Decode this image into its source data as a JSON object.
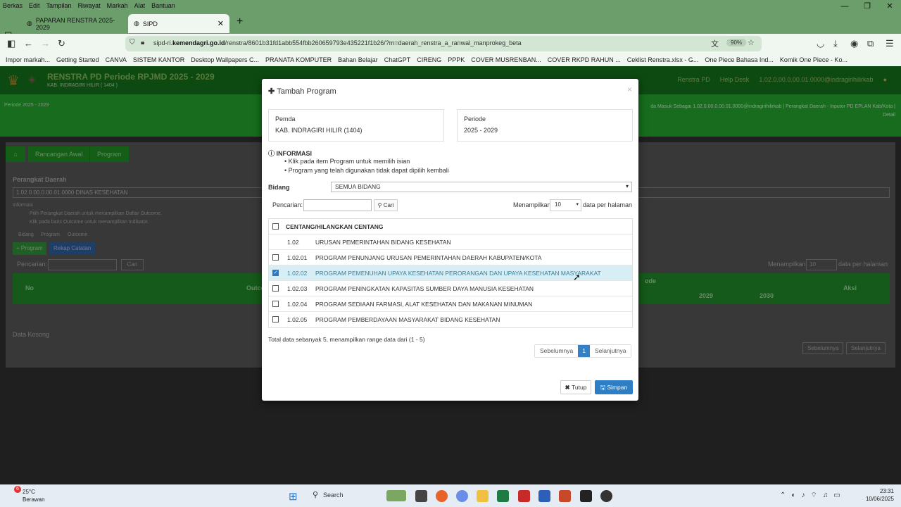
{
  "browser": {
    "menu": [
      "Berkas",
      "Edit",
      "Tampilan",
      "Riwayat",
      "Markah",
      "Alat",
      "Bantuan"
    ],
    "tabs": [
      {
        "label": "PAPARAN RENSTRA 2025-2029"
      },
      {
        "label": "SIPD"
      }
    ],
    "url_prefix": "sipd-ri.",
    "url_domain": "kemendagri.go.id",
    "url_rest": "/renstra/8601b31fd1abb554fbb260659793e435221f1b26/?m=daerah_renstra_a_ranwal_manprokeg_beta",
    "zoom": "90%",
    "bookmarks": [
      "Impor markah...",
      "Getting Started",
      "CANVA",
      "SISTEM KANTOR",
      "Desktop Wallpapers C...",
      "PRANATA KOMPUTER",
      "Bahan Belajar",
      "ChatGPT",
      "CIRENG",
      "PPPK",
      "COVER MUSRENBAN...",
      "COVER RKPD RAHUN ...",
      "Ceklist Renstra.xlsx - G...",
      "One Piece Bahasa Ind...",
      "Komik One Piece - Ko..."
    ]
  },
  "site": {
    "title": "RENSTRA PD Periode RPJMD 2025 - 2029",
    "subtitle": "KAB. INDRAGIRI HILIR ( 1404 )",
    "nav_right": [
      "Renstra PD",
      "Help Desk",
      "1.02.0.00.0.00.01.0000@indragirihilirkab"
    ],
    "periode_small": "Periode 2025 - 2029",
    "status_line": "da Masuk Sebagai 1.02.0.00.0.00.01.0000@indragirihilirkab | Perangkat Daerah - Inputor PD EPLAN Kab/Kota |",
    "detail": "Detail",
    "breadcrumb": [
      "Rancangan Awal",
      "Program"
    ],
    "perangkat_label": "Perangkat Daerah",
    "perangkat_value": "1.02.0.00.0.00.01.0000 DINAS KESEHATAN",
    "informasi": "Informasi",
    "info_items": [
      "Pilih Perangkat Daerah untuk menampilkan Daftar Outcome.",
      "Klik pada baris Outcome untuk menampilkan Indikator."
    ],
    "legend": [
      "Bidang",
      "Program",
      "Outcome"
    ],
    "btn_program": "+ Program",
    "btn_rekap": "Rekap Catatan",
    "pencarian": "Pencarian:",
    "cari": "Cari",
    "menampilkan": "Menampilkan",
    "perpage": "10",
    "perhal": "data per halaman",
    "columns": [
      "No",
      "Outco",
      "ode",
      "2029",
      "2030",
      "Aksi"
    ],
    "empty": "Data Kosong",
    "prev": "Sebelumnya",
    "next": "Selanjutnya"
  },
  "modal": {
    "title": "Tambah Program",
    "close": "×",
    "pemda_label": "Pemda",
    "pemda_value": "KAB. INDRAGIRI HILIR (1404)",
    "periode_label": "Periode",
    "periode_value": "2025 - 2029",
    "informasi": "INFORMASI",
    "info_items": [
      "Klik pada item Program untuk memilih isian",
      "Program yang telah digunakan tidak dapat dipilih kembali"
    ],
    "bidang_label": "Bidang",
    "bidang_value": "SEMUA BIDANG",
    "pencarian": "Pencarian:",
    "cari": "Cari",
    "menampilkan": "Menampilkan",
    "perpage": "10",
    "perhal": "data per halaman",
    "header_check": "CENTANG/HILANGKAN CENTANG",
    "rows": [
      {
        "code": "1.02",
        "name": "URUSAN PEMERINTAHAN BIDANG KESEHATAN",
        "checkbox": false,
        "checked": false
      },
      {
        "code": "1.02.01",
        "name": "PROGRAM PENUNJANG URUSAN PEMERINTAHAN DAERAH KABUPATEN/KOTA",
        "checkbox": true,
        "checked": false
      },
      {
        "code": "1.02.02",
        "name": "PROGRAM PEMENUHAN UPAYA KESEHATAN PERORANGAN DAN UPAYA KESEHATAN MASYARAKAT",
        "checkbox": true,
        "checked": true
      },
      {
        "code": "1.02.03",
        "name": "PROGRAM PENINGKATAN KAPASITAS SUMBER DAYA MANUSIA KESEHATAN",
        "checkbox": true,
        "checked": false
      },
      {
        "code": "1.02.04",
        "name": "PROGRAM SEDIAAN FARMASI, ALAT KESEHATAN DAN MAKANAN MINUMAN",
        "checkbox": true,
        "checked": false
      },
      {
        "code": "1.02.05",
        "name": "PROGRAM PEMBERDAYAAN MASYARAKAT BIDANG KESEHATAN",
        "checkbox": true,
        "checked": false
      }
    ],
    "total": "Total data sebanyak 5, menampilkan range data dari (1 - 5)",
    "prev": "Sebelumnya",
    "page": "1",
    "next": "Selanjutnya",
    "tutup": "Tutup",
    "simpan": "Simpan"
  },
  "taskbar": {
    "temp": "25°C",
    "weather": "Berawan",
    "badge": "6",
    "search": "Search",
    "time": "23:31",
    "date": "10/06/2025"
  }
}
